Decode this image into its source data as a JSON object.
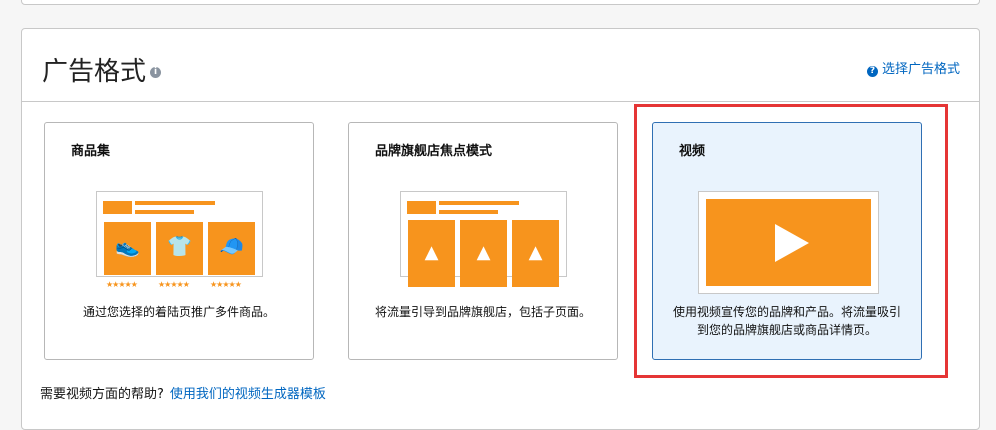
{
  "section": {
    "title": "广告格式",
    "help_link": "选择广告格式"
  },
  "cards": [
    {
      "title": "商品集",
      "description": "通过您选择的着陆页推广多件商品。"
    },
    {
      "title": "品牌旗舰店焦点模式",
      "description": "将流量引导到品牌旗舰店，包括子页面。"
    },
    {
      "title": "视频",
      "description": "使用视频宣传您的品牌和产品。将流量吸引到您的品牌旗舰店或商品详情页。",
      "selected": true
    }
  ],
  "footer": {
    "question": "需要视频方面的帮助?",
    "link": "使用我们的视频生成器模板"
  },
  "colors": {
    "accent": "#f7941d",
    "link": "#0066c0",
    "highlight": "#e53535"
  }
}
